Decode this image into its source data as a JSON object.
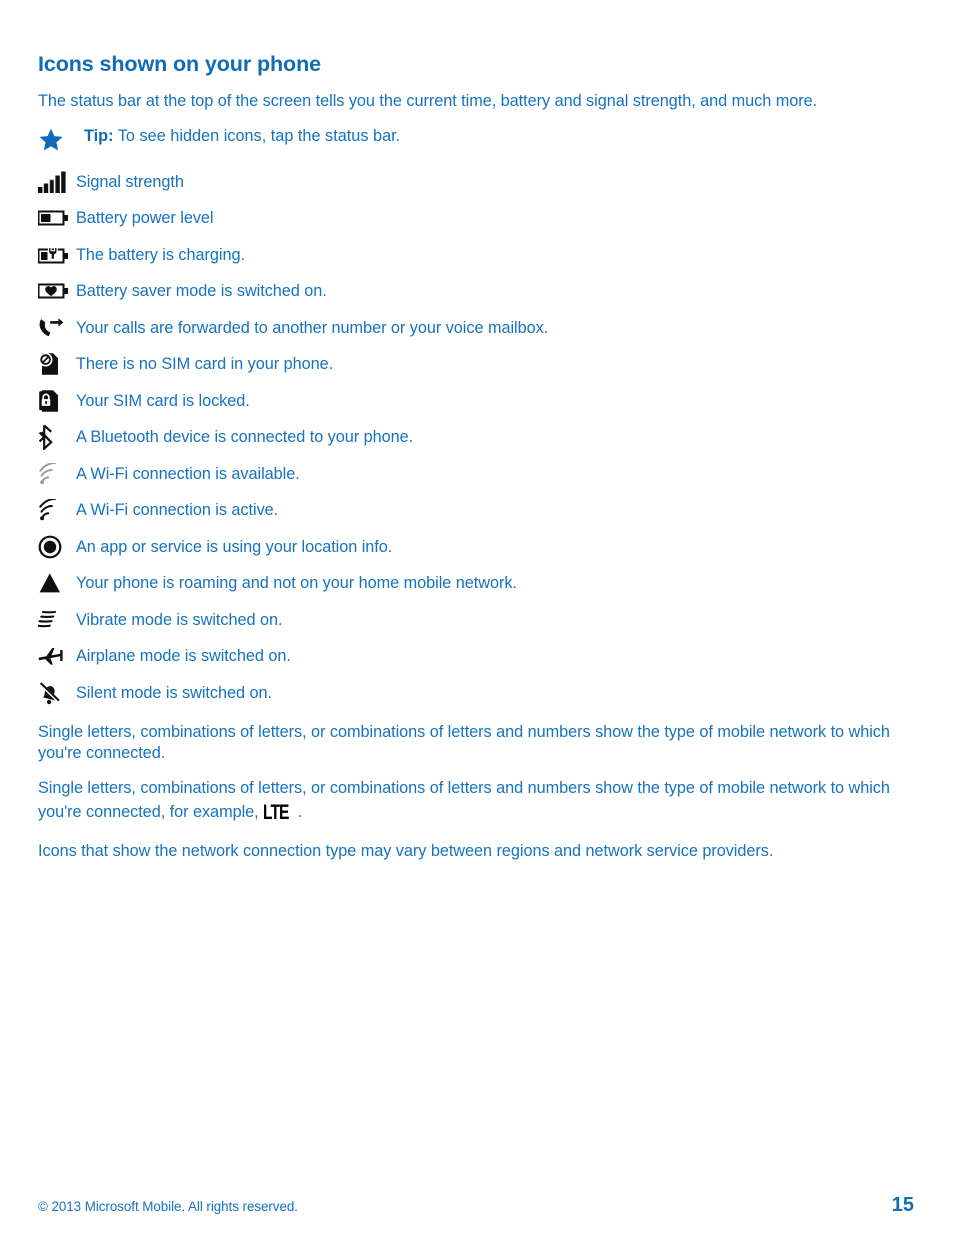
{
  "document": {
    "title": "Icons shown on your phone",
    "intro": "The status bar at the top of the screen tells you the current time, battery and signal strength, and much more.",
    "tip": {
      "icon": "star-icon",
      "label": "Tip:",
      "text": "To see hidden icons, tap the status bar."
    },
    "icon_list": [
      {
        "icon": "signal-strength-icon",
        "label": "Signal strength"
      },
      {
        "icon": "battery-level-icon",
        "label": "Battery power level"
      },
      {
        "icon": "battery-charging-icon",
        "label": "The battery is charging."
      },
      {
        "icon": "battery-saver-icon",
        "label": "Battery saver mode is switched on."
      },
      {
        "icon": "call-forwarding-icon",
        "label": "Your calls are forwarded to another number or your voice mailbox."
      },
      {
        "icon": "no-sim-card-icon",
        "label": "There is no SIM card in your phone."
      },
      {
        "icon": "sim-locked-icon",
        "label": "Your SIM card is locked."
      },
      {
        "icon": "bluetooth-icon",
        "label": "A Bluetooth device is connected to your phone."
      },
      {
        "icon": "wifi-available-icon",
        "label": "A Wi-Fi connection is available."
      },
      {
        "icon": "wifi-active-icon",
        "label": "A Wi-Fi connection is active."
      },
      {
        "icon": "location-icon",
        "label": "An app or service is using your location info."
      },
      {
        "icon": "roaming-icon",
        "label": "Your phone is roaming and not on your home mobile network."
      },
      {
        "icon": "vibrate-icon",
        "label": "Vibrate mode is switched on."
      },
      {
        "icon": "airplane-mode-icon",
        "label": "Airplane mode is switched on."
      },
      {
        "icon": "silent-mode-icon",
        "label": "Silent mode is switched on."
      }
    ],
    "tail_paragraphs": {
      "para1": "Single letters, combinations of letters, or combinations of letters and numbers show the type of mobile network to which you're connected.",
      "para2_before": "Single letters, combinations of letters, or combinations of letters and numbers show the type of mobile network to which you're connected, for example, ",
      "para2_mark": "LTE",
      "para2_after": ".",
      "para3": "Icons that show the network connection type may vary between regions and network service providers."
    }
  },
  "footer": {
    "copyright": "© 2013 Microsoft Mobile. All rights reserved.",
    "page_number": "15"
  },
  "colors": {
    "heading_blue": "#0f6cb5",
    "body_blue": "#1573bf",
    "icon_black": "#101010",
    "icon_gray": "#8c8c8c"
  }
}
